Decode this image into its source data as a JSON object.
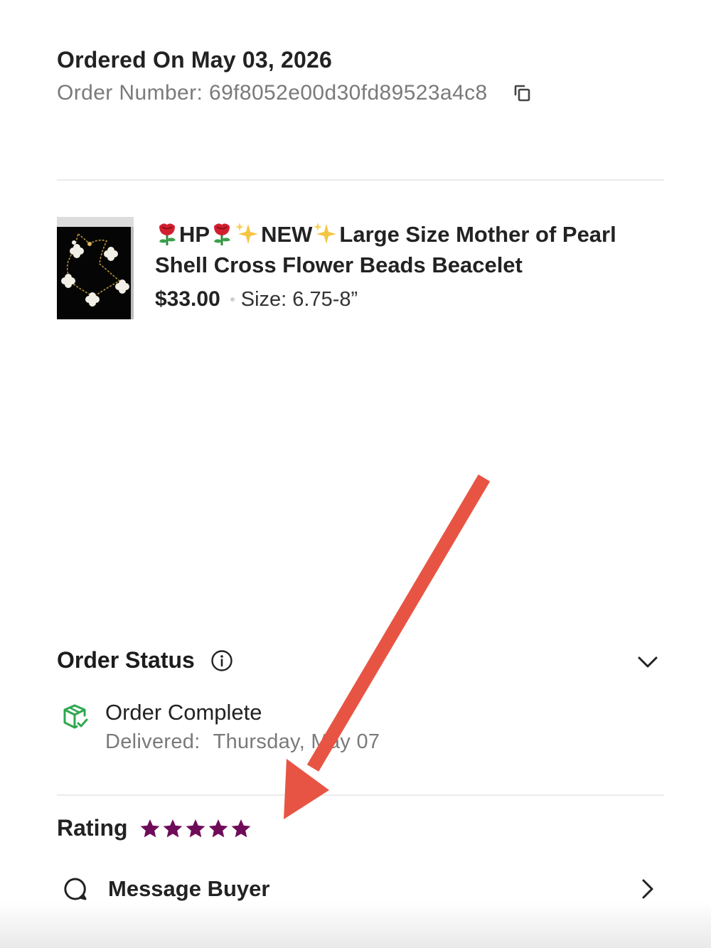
{
  "order": {
    "date_label": "Ordered On May 03, 2026",
    "number_label": "Order Number: 69f8052e00d30fd89523a4c8"
  },
  "product": {
    "title_part1": "HP",
    "title_part2": "NEW",
    "title_part3": "Large Size Mother of Pearl Shell Cross Flower Beads Beacelet",
    "price": "$33.00",
    "size": "Size: 6.75-8”"
  },
  "order_status": {
    "heading": "Order Status",
    "status": "Order Complete",
    "delivered_label": "Delivered:",
    "delivered_date": "Thursday, May 07"
  },
  "rating": {
    "label": "Rating",
    "stars": 5,
    "star_color": "#6f0c5a"
  },
  "message": {
    "label": "Message Buyer"
  },
  "colors": {
    "annotation_arrow": "#e85444",
    "status_green": "#2fa84f"
  }
}
